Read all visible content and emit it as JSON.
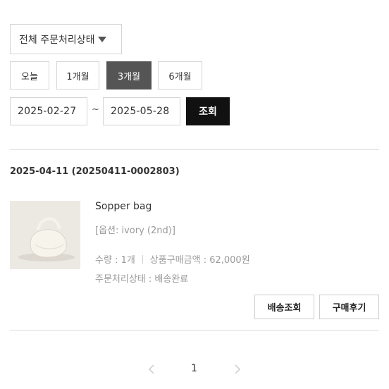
{
  "filters": {
    "status_select": "전체 주문처리상태",
    "periods": [
      "오늘",
      "1개월",
      "3개월",
      "6개월"
    ],
    "active_period": "3개월",
    "date_from": "2025-02-27",
    "date_separator": "~",
    "date_to": "2025-05-28",
    "search_label": "조회"
  },
  "order": {
    "header": "2025-04-11 (20250411-0002803)",
    "item": {
      "name": "Sopper bag",
      "option": "[옵션: ivory (2nd)]",
      "quantity": "수량 : 1개",
      "price": "상품구매금액 : 62,000원",
      "status": "주문처리상태 : 배송완료"
    },
    "actions": {
      "track_label": "배송조회",
      "review_label": "구매후기"
    }
  },
  "pagination": {
    "current": "1",
    "prev_icon": "chevron-left-icon",
    "next_icon": "chevron-right-icon"
  },
  "colors": {
    "active_period_bg": "#555555",
    "search_button_bg": "#111111"
  }
}
